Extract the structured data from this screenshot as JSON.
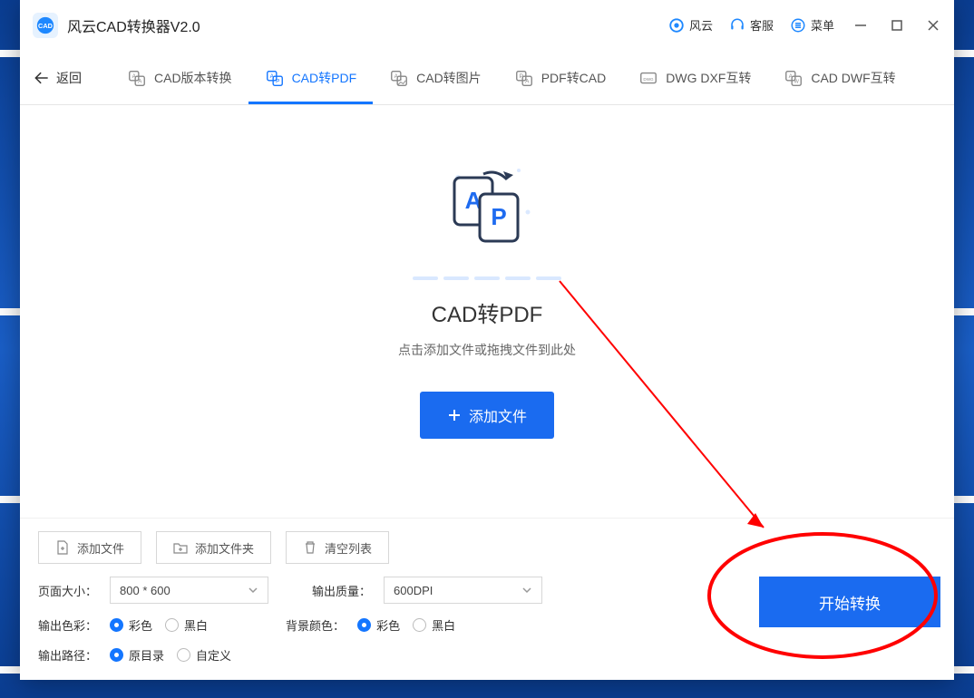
{
  "titlebar": {
    "app_title": "风云CAD转换器V2.0",
    "brand": "风云",
    "support": "客服",
    "menu": "菜单"
  },
  "tabs": {
    "back": "返回",
    "items": [
      {
        "label": "CAD版本转换"
      },
      {
        "label": "CAD转PDF"
      },
      {
        "label": "CAD转图片"
      },
      {
        "label": "PDF转CAD"
      },
      {
        "label": "DWG DXF互转"
      },
      {
        "label": "CAD DWF互转"
      }
    ],
    "active_index": 1
  },
  "main": {
    "title": "CAD转PDF",
    "hint": "点击添加文件或拖拽文件到此处",
    "add_file": "添加文件"
  },
  "footer": {
    "add_file": "添加文件",
    "add_folder": "添加文件夹",
    "clear_list": "清空列表",
    "page_size_label": "页面大小：",
    "page_size_value": "800 * 600",
    "output_quality_label": "输出质量：",
    "output_quality_value": "600DPI",
    "output_color_label": "输出色彩：",
    "color_color": "彩色",
    "color_bw": "黑白",
    "bg_color_label": "背景颜色：",
    "bg_color_color": "彩色",
    "bg_color_bw": "黑白",
    "output_path_label": "输出路径：",
    "path_original": "原目录",
    "path_custom": "自定义",
    "convert": "开始转换"
  }
}
